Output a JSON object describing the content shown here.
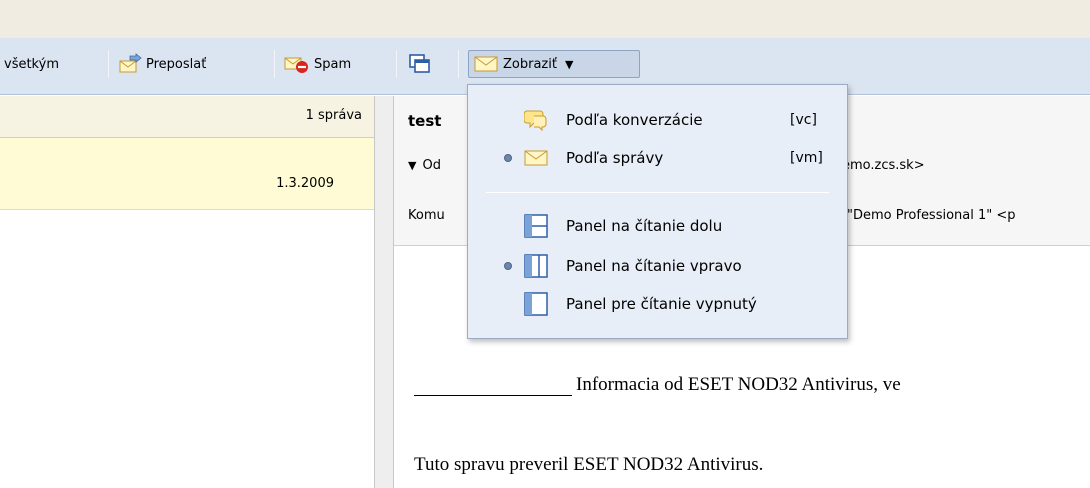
{
  "toolbar": {
    "reply_all_label": "všetkým",
    "forward_label": "Preposlať",
    "spam_label": "Spam",
    "view_label": "Zobraziť"
  },
  "list": {
    "count": "1 správa",
    "row_date": "1.3.2009"
  },
  "message": {
    "subject": "test",
    "from_prefix": "Od",
    "from_address_tail": "emo.zcs.sk>",
    "to_prefix": "Komu",
    "to_address": "\"Demo Professional 1\" <p",
    "body_line1": "Informacia od ESET NOD32 Antivirus, ve",
    "body_line2": "Tuto spravu preveril ESET NOD32 Antivirus."
  },
  "view_menu": {
    "items": [
      {
        "label": "Podľa konverzácie",
        "shortcut": "[vc]"
      },
      {
        "label": "Podľa správy",
        "shortcut": "[vm]"
      },
      {
        "label": "Panel na čítanie dolu"
      },
      {
        "label": "Panel na čítanie vpravo"
      },
      {
        "label": "Panel pre čítanie vypnutý"
      }
    ]
  },
  "colors": {
    "toolbar_bg": "#dbe4f1",
    "selected_row": "#fffbd5",
    "menu_bg": "#e8eef7"
  }
}
